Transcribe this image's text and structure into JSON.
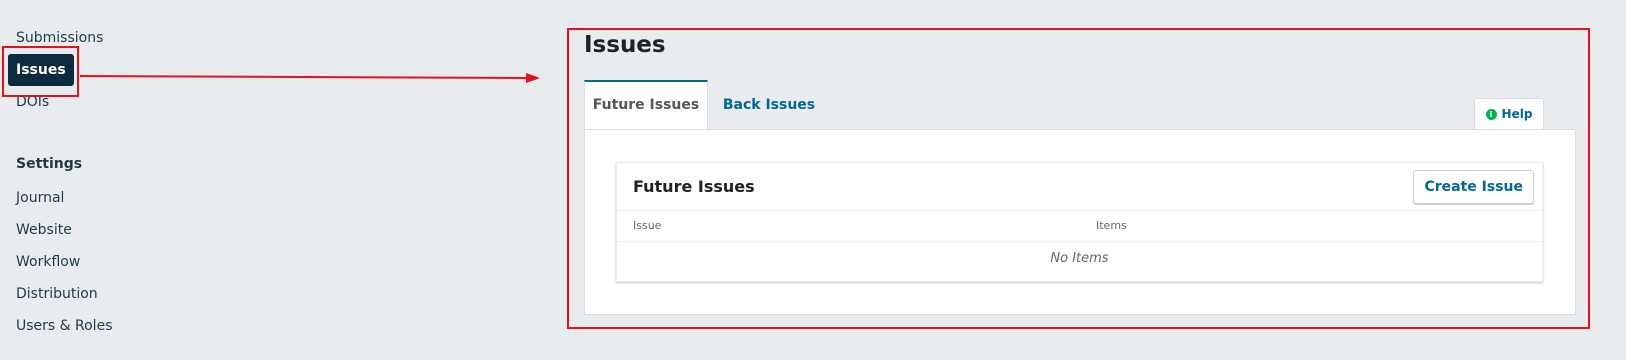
{
  "sidebar": {
    "items": [
      {
        "label": "Submissions"
      },
      {
        "label": "Issues"
      },
      {
        "label": "DOIs"
      }
    ],
    "settings_heading": "Settings",
    "settings_items": [
      {
        "label": "Journal"
      },
      {
        "label": "Website"
      },
      {
        "label": "Workflow"
      },
      {
        "label": "Distribution"
      },
      {
        "label": "Users & Roles"
      }
    ]
  },
  "main": {
    "title": "Issues",
    "tabs": [
      {
        "label": "Future Issues"
      },
      {
        "label": "Back Issues"
      }
    ],
    "help_label": "Help",
    "grid": {
      "title": "Future Issues",
      "create_label": "Create Issue",
      "columns": [
        "Issue",
        "Items"
      ],
      "empty_text": "No Items"
    }
  },
  "colors": {
    "active_nav_bg": "#0d2b3e",
    "link": "#006798",
    "annotation": "#e8101c",
    "help_icon": "#00b24e"
  },
  "icons": {
    "help": "info-circle-icon"
  }
}
